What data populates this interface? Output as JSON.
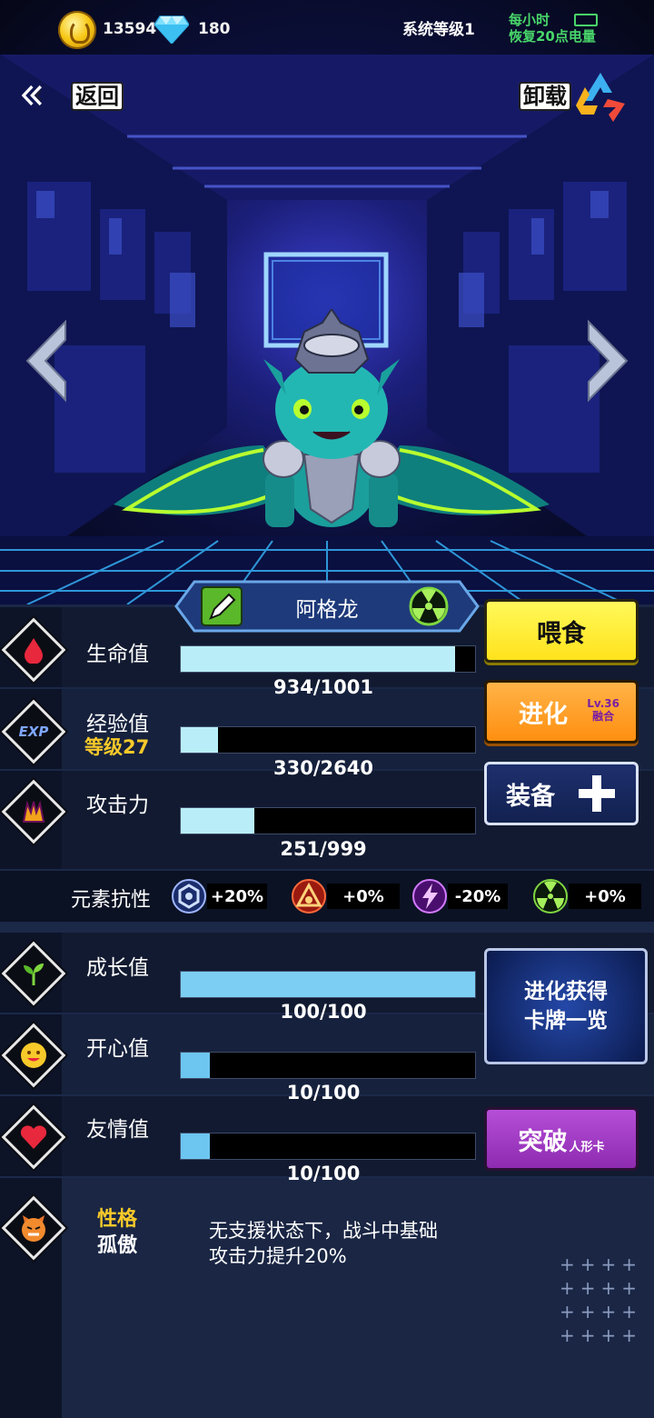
{
  "resources": {
    "gold": "13594",
    "diamonds": "180"
  },
  "system": {
    "level_text": "系统等级1",
    "energy_line1": "每小时",
    "energy_line2": "恢复20点电量"
  },
  "nav": {
    "back_label": "返回",
    "unload_label": "卸载"
  },
  "pet": {
    "name": "阿格龙"
  },
  "stats": {
    "hp": {
      "label": "生命值",
      "current": 934,
      "max": 1001,
      "value_text": "934/1001"
    },
    "exp": {
      "label": "经验值",
      "level_text": "等级27",
      "current": 330,
      "max": 2640,
      "value_text": "330/2640"
    },
    "attack": {
      "label": "攻击力",
      "current": 251,
      "max": 999,
      "value_text": "251/999"
    },
    "growth": {
      "label": "成长值",
      "current": 100,
      "max": 100,
      "value_text": "100/100"
    },
    "happy": {
      "label": "开心值",
      "current": 10,
      "max": 100,
      "value_text": "10/100"
    },
    "friend": {
      "label": "友情值",
      "current": 10,
      "max": 100,
      "value_text": "10/100"
    }
  },
  "resistance": {
    "label": "元素抗性",
    "items": [
      {
        "icon": "shield-icon",
        "value": "+20%"
      },
      {
        "icon": "fire-icon",
        "value": "+0%"
      },
      {
        "icon": "lightning-icon",
        "value": "-20%"
      },
      {
        "icon": "radiation-icon",
        "value": "+0%"
      }
    ]
  },
  "buttons": {
    "feed": "喂食",
    "evolve": "进化",
    "evolve_badge_1": "Lv.36",
    "evolve_badge_2": "融合",
    "equip": "装备",
    "cards_1": "进化获得",
    "cards_2": "卡牌一览",
    "breakthrough": "突破",
    "breakthrough_sub": "人形卡"
  },
  "trait": {
    "title": "性格",
    "name": "孤傲",
    "desc_line1": "无支援状态下，战斗中基础",
    "desc_line2": "攻击力提升20%"
  },
  "colors": {
    "hp_bar": "#b9eef8",
    "exp_bar": "#b9eef8",
    "atk_bar": "#b9eef8",
    "growth_bar": "#7ccff2",
    "happy_bar": "#6cc6f0",
    "friend_bar": "#6cc6f0",
    "accent_gold": "#f7c92a"
  }
}
